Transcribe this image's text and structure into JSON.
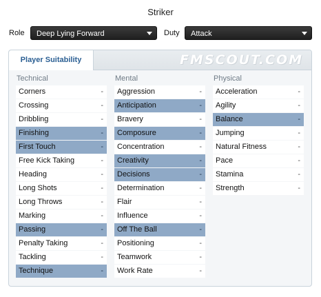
{
  "title": "Striker",
  "role": {
    "label": "Role",
    "value": "Deep Lying Forward"
  },
  "duty": {
    "label": "Duty",
    "value": "Attack"
  },
  "tab": "Player Suitability",
  "watermark": "FMSCOUT.COM",
  "columns": [
    {
      "heading": "Technical",
      "attributes": [
        {
          "name": "Corners",
          "value": "-",
          "highlighted": false
        },
        {
          "name": "Crossing",
          "value": "-",
          "highlighted": false
        },
        {
          "name": "Dribbling",
          "value": "-",
          "highlighted": false
        },
        {
          "name": "Finishing",
          "value": "-",
          "highlighted": true
        },
        {
          "name": "First Touch",
          "value": "-",
          "highlighted": true
        },
        {
          "name": "Free Kick Taking",
          "value": "-",
          "highlighted": false
        },
        {
          "name": "Heading",
          "value": "-",
          "highlighted": false
        },
        {
          "name": "Long Shots",
          "value": "-",
          "highlighted": false
        },
        {
          "name": "Long Throws",
          "value": "-",
          "highlighted": false
        },
        {
          "name": "Marking",
          "value": "-",
          "highlighted": false
        },
        {
          "name": "Passing",
          "value": "-",
          "highlighted": true
        },
        {
          "name": "Penalty Taking",
          "value": "-",
          "highlighted": false
        },
        {
          "name": "Tackling",
          "value": "-",
          "highlighted": false
        },
        {
          "name": "Technique",
          "value": "-",
          "highlighted": true
        }
      ]
    },
    {
      "heading": "Mental",
      "attributes": [
        {
          "name": "Aggression",
          "value": "-",
          "highlighted": false
        },
        {
          "name": "Anticipation",
          "value": "-",
          "highlighted": true
        },
        {
          "name": "Bravery",
          "value": "-",
          "highlighted": false
        },
        {
          "name": "Composure",
          "value": "-",
          "highlighted": true
        },
        {
          "name": "Concentration",
          "value": "-",
          "highlighted": false
        },
        {
          "name": "Creativity",
          "value": "-",
          "highlighted": true
        },
        {
          "name": "Decisions",
          "value": "-",
          "highlighted": true
        },
        {
          "name": "Determination",
          "value": "-",
          "highlighted": false
        },
        {
          "name": "Flair",
          "value": "-",
          "highlighted": false
        },
        {
          "name": "Influence",
          "value": "-",
          "highlighted": false
        },
        {
          "name": "Off The Ball",
          "value": "-",
          "highlighted": true
        },
        {
          "name": "Positioning",
          "value": "-",
          "highlighted": false
        },
        {
          "name": "Teamwork",
          "value": "-",
          "highlighted": false
        },
        {
          "name": "Work Rate",
          "value": "-",
          "highlighted": false
        }
      ]
    },
    {
      "heading": "Physical",
      "attributes": [
        {
          "name": "Acceleration",
          "value": "-",
          "highlighted": false
        },
        {
          "name": "Agility",
          "value": "-",
          "highlighted": false
        },
        {
          "name": "Balance",
          "value": "-",
          "highlighted": true
        },
        {
          "name": "Jumping",
          "value": "-",
          "highlighted": false
        },
        {
          "name": "Natural Fitness",
          "value": "-",
          "highlighted": false
        },
        {
          "name": "Pace",
          "value": "-",
          "highlighted": false
        },
        {
          "name": "Stamina",
          "value": "-",
          "highlighted": false
        },
        {
          "name": "Strength",
          "value": "-",
          "highlighted": false
        }
      ]
    }
  ]
}
